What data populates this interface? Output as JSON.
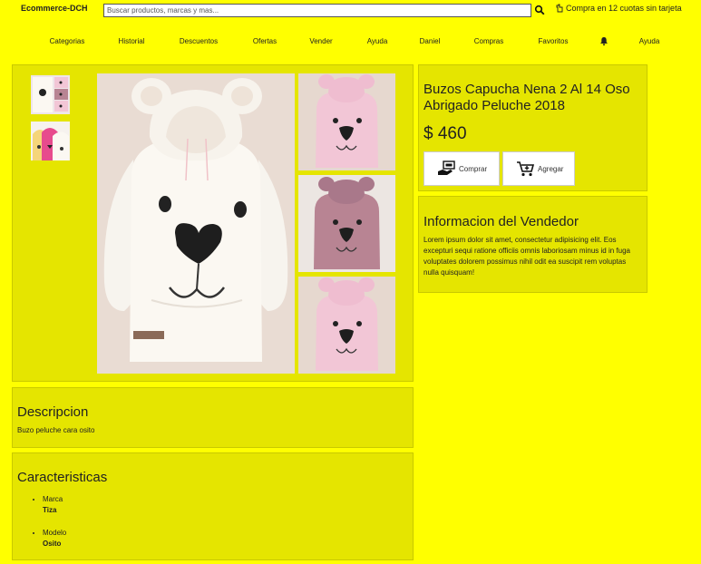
{
  "header": {
    "brand": "Ecommerce-DCH",
    "search_placeholder": "Buscar productos, marcas y mas...",
    "promo": "Compra en 12 cuotas sin tarjeta"
  },
  "nav": {
    "items": [
      "Categorias",
      "Historial",
      "Descuentos",
      "Ofertas",
      "Vender",
      "Ayuda",
      "Daniel",
      "Compras",
      "Favoritos",
      "Ayuda"
    ]
  },
  "product": {
    "title": "Buzos Capucha Nena 2 Al 14 Oso Abrigado Peluche 2018",
    "price": "$ 460",
    "buy_label": "Comprar",
    "add_label": "Agregar"
  },
  "seller": {
    "heading": "Informacion del Vendedor",
    "text": "Lorem ipsum dolor sit amet, consectetur adipisicing elit. Eos excepturi sequi ratione officiis omnis laboriosam minus id in fuga voluptates dolorem possimus nihil odit ea suscipit rem voluptas nulla quisquam!"
  },
  "description": {
    "heading": "Descripcion",
    "text": "Buzo peluche cara osito"
  },
  "features": {
    "heading": "Caracteristicas",
    "items": [
      {
        "label": "Marca",
        "value": "Tiza"
      },
      {
        "label": "Modelo",
        "value": "Osito"
      }
    ]
  },
  "colors": {
    "page_bg": "#ffff00",
    "panel_bg": "#e5e500",
    "white_hoodie": "#fbf8f2",
    "pink_hoodie": "#f2c6d6",
    "mauve_hoodie": "#b88493",
    "photo_bg": "#e6d8cf"
  }
}
